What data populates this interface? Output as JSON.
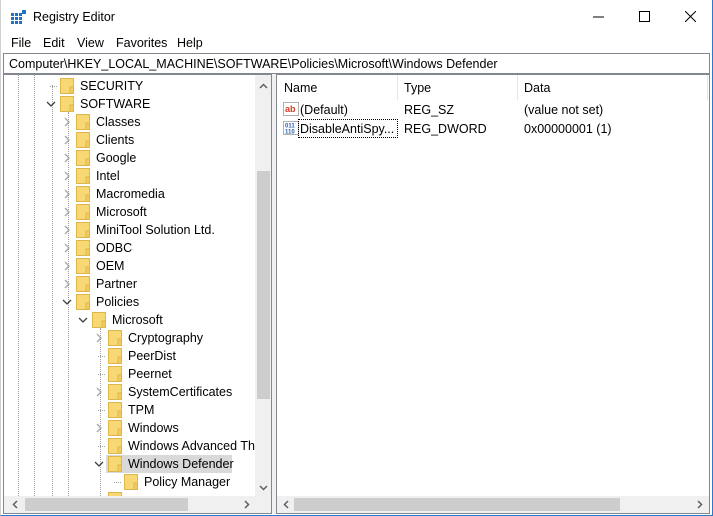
{
  "window": {
    "title": "Registry Editor",
    "controls": {
      "minimize": "minimize",
      "maximize": "maximize",
      "close": "close"
    }
  },
  "menu": {
    "items": [
      "File",
      "Edit",
      "View",
      "Favorites",
      "Help"
    ]
  },
  "address": {
    "path": "Computer\\HKEY_LOCAL_MACHINE\\SOFTWARE\\Policies\\Microsoft\\Windows Defender"
  },
  "tree": {
    "nodes": [
      {
        "label": "SECURITY",
        "level": 0,
        "state": "leaf"
      },
      {
        "label": "SOFTWARE",
        "level": 0,
        "state": "expanded"
      },
      {
        "label": "Classes",
        "level": 1,
        "state": "collapsed"
      },
      {
        "label": "Clients",
        "level": 1,
        "state": "collapsed"
      },
      {
        "label": "Google",
        "level": 1,
        "state": "collapsed"
      },
      {
        "label": "Intel",
        "level": 1,
        "state": "collapsed"
      },
      {
        "label": "Macromedia",
        "level": 1,
        "state": "collapsed"
      },
      {
        "label": "Microsoft",
        "level": 1,
        "state": "collapsed"
      },
      {
        "label": "MiniTool Solution Ltd.",
        "level": 1,
        "state": "collapsed"
      },
      {
        "label": "ODBC",
        "level": 1,
        "state": "collapsed"
      },
      {
        "label": "OEM",
        "level": 1,
        "state": "collapsed"
      },
      {
        "label": "Partner",
        "level": 1,
        "state": "collapsed"
      },
      {
        "label": "Policies",
        "level": 1,
        "state": "expanded"
      },
      {
        "label": "Microsoft",
        "level": 2,
        "state": "expanded"
      },
      {
        "label": "Cryptography",
        "level": 3,
        "state": "collapsed"
      },
      {
        "label": "PeerDist",
        "level": 3,
        "state": "leaf"
      },
      {
        "label": "Peernet",
        "level": 3,
        "state": "leaf"
      },
      {
        "label": "SystemCertificates",
        "level": 3,
        "state": "collapsed"
      },
      {
        "label": "TPM",
        "level": 3,
        "state": "leaf"
      },
      {
        "label": "Windows",
        "level": 3,
        "state": "collapsed"
      },
      {
        "label": "Windows Advanced Thr",
        "level": 3,
        "state": "leaf"
      },
      {
        "label": "Windows Defender",
        "level": 3,
        "state": "expanded",
        "selected": true
      },
      {
        "label": "Policy Manager",
        "level": 4,
        "state": "leaf"
      }
    ]
  },
  "list": {
    "columns": [
      "Name",
      "Type",
      "Data"
    ],
    "rows": [
      {
        "icon": "string-value-icon",
        "name": "(Default)",
        "type": "REG_SZ",
        "data": "(value not set)"
      },
      {
        "icon": "binary-value-icon",
        "name": "DisableAntiSpy...",
        "type": "REG_DWORD",
        "data": "0x00000001 (1)",
        "focused": true
      }
    ]
  },
  "colors": {
    "folder": "#f8d775",
    "folder_edge": "#e0b64a",
    "selection": "#d9d9d9",
    "window_border": "#2b79d0",
    "scroll_thumb": "#cdcdcd"
  }
}
